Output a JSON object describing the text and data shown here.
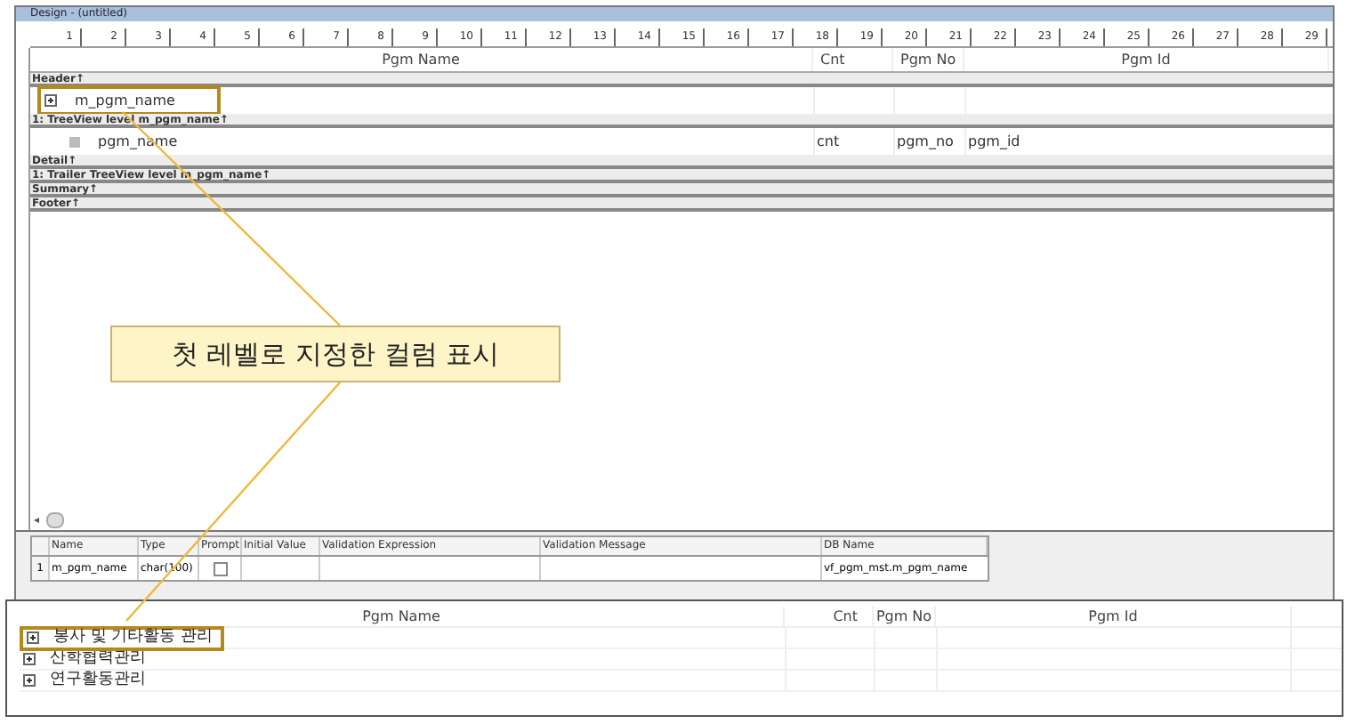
{
  "window": {
    "title": "Design - (untitled)"
  },
  "ruler": {
    "ticks": [
      "1",
      "2",
      "3",
      "4",
      "5",
      "6",
      "7",
      "8",
      "9",
      "10",
      "11",
      "12",
      "13",
      "14",
      "15",
      "16",
      "17",
      "18",
      "19",
      "20",
      "21",
      "22",
      "23",
      "24",
      "25",
      "26",
      "27",
      "28",
      "29"
    ]
  },
  "design": {
    "columns": [
      "Pgm Name",
      "Cnt",
      "Pgm No",
      "Pgm Id"
    ],
    "sections": [
      {
        "kind": "band",
        "label": "Header↑"
      },
      {
        "kind": "parent_row",
        "cells": [
          "m_pgm_name",
          "",
          "",
          ""
        ],
        "highlighted": true
      },
      {
        "kind": "band",
        "label": "1: TreeView level m_pgm_name↑"
      },
      {
        "kind": "child_row",
        "cells": [
          "pgm_name",
          "cnt",
          "pgm_no",
          "pgm_id"
        ],
        "highlighted": false
      },
      {
        "kind": "band",
        "label": "Detail↑"
      },
      {
        "kind": "band",
        "label": "1: Trailer TreeView level m_pgm_name↑"
      },
      {
        "kind": "band",
        "label": "Summary↑"
      },
      {
        "kind": "band",
        "label": "Footer↑"
      }
    ]
  },
  "callout": {
    "text": "첫 레벨로 지정한 컬럼 표시"
  },
  "scroll": {
    "arrow": "◂"
  },
  "grid": {
    "columns": [
      "Name",
      "Type",
      "Prompt",
      "Initial Value",
      "Validation Expression",
      "Validation Message",
      "DB Name"
    ],
    "rows": [
      {
        "number": "1",
        "name": "m_pgm_name",
        "type": "char(100)",
        "prompt_checked": false,
        "db_name": "vf_pgm_mst.m_pgm_name"
      }
    ]
  },
  "preview": {
    "columns": [
      "Pgm Name",
      "Cnt",
      "Pgm No",
      "Pgm Id"
    ],
    "rows": [
      {
        "label": "봉사 및 기타활동 관리",
        "highlighted": true
      },
      {
        "label": "산학협력관리",
        "highlighted": false
      },
      {
        "label": "연구활동관리",
        "highlighted": false
      }
    ]
  }
}
